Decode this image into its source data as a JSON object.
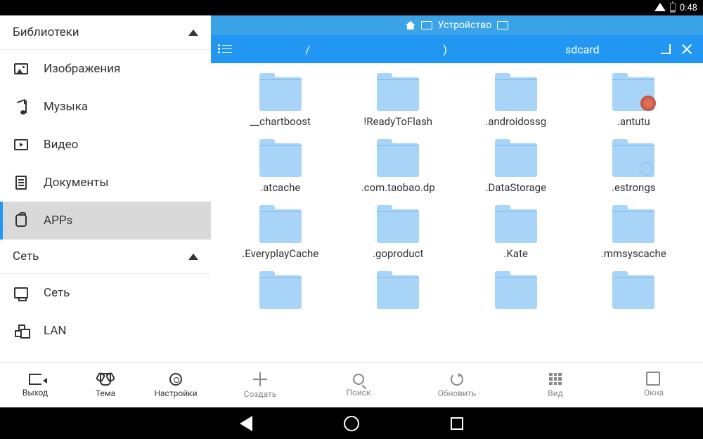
{
  "status": {
    "time": "0:48"
  },
  "sidebar": {
    "sections": {
      "libs": {
        "title": "Библиотеки"
      },
      "net": {
        "title": "Сеть"
      }
    },
    "items": {
      "images": "Изображения",
      "music": "Музыка",
      "video": "Видео",
      "docs": "Документы",
      "apps": "APPs",
      "network": "Сеть",
      "lan": "LAN"
    },
    "bottom": {
      "exit": "Выход",
      "theme": "Тема",
      "settings": "Настройки"
    }
  },
  "tabs": {
    "device": "Устройство"
  },
  "path": {
    "root": "/",
    "mid": ")",
    "cur": "sdcard"
  },
  "folders": [
    "__chartboost",
    "!ReadyToFlash",
    ".androidossg",
    ".antutu",
    ".atcache",
    ".com.taobao.dp",
    ".DataStorage",
    ".estrongs",
    ".EveryplayCache",
    ".goproduct",
    ".Kate",
    ".mmsyscache",
    "",
    "",
    "",
    ""
  ],
  "mainbottom": {
    "create": "Создать",
    "search": "Поиск",
    "refresh": "Обновить",
    "view": "Вид",
    "windows": "Окна"
  }
}
